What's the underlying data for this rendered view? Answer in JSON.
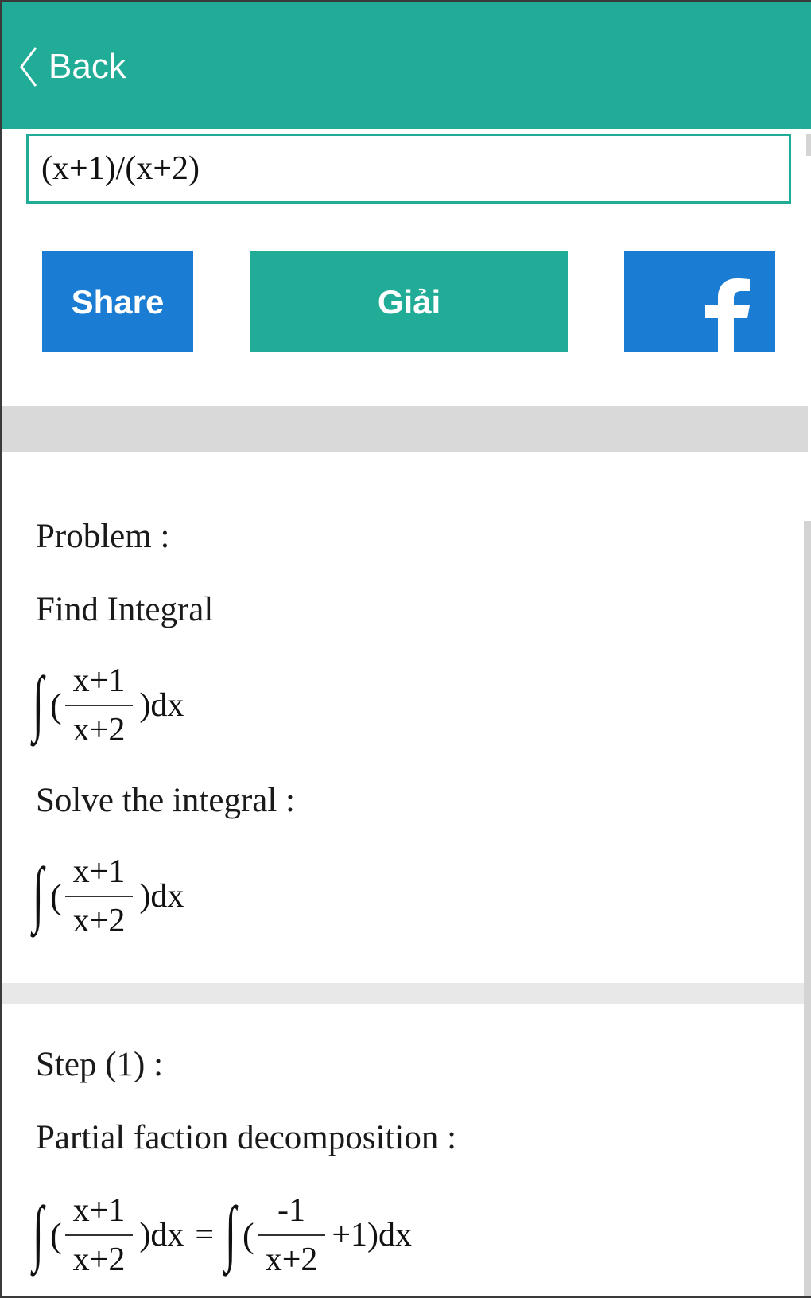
{
  "header": {
    "back_label": "Back",
    "color": "#20ac96"
  },
  "input": {
    "value": "(x+1)/(x+2)"
  },
  "buttons": {
    "share_label": "Share",
    "solve_label": "Giải",
    "facebook_icon": "facebook-icon",
    "share_color": "#1a7dd3",
    "solve_color": "#20ac96"
  },
  "problem": {
    "heading": "Problem :",
    "task": "Find Integral",
    "expr": {
      "integral": "∫",
      "open": "(",
      "numerator": "x+1",
      "denominator": "x+2",
      "close": ")dx"
    },
    "solve_heading": "Solve the integral :",
    "solve_expr": {
      "integral": "∫",
      "open": "(",
      "numerator": "x+1",
      "denominator": "x+2",
      "close": ")dx"
    }
  },
  "step1": {
    "heading": "Step (1) :",
    "title": "Partial faction decomposition :",
    "lhs": {
      "integral": "∫",
      "open": "(",
      "numerator": "x+1",
      "denominator": "x+2",
      "close": ")dx"
    },
    "equals": "=",
    "rhs": {
      "integral": "∫",
      "open": "(",
      "numerator": "-1",
      "denominator": "x+2",
      "close": "+1)dx"
    }
  }
}
